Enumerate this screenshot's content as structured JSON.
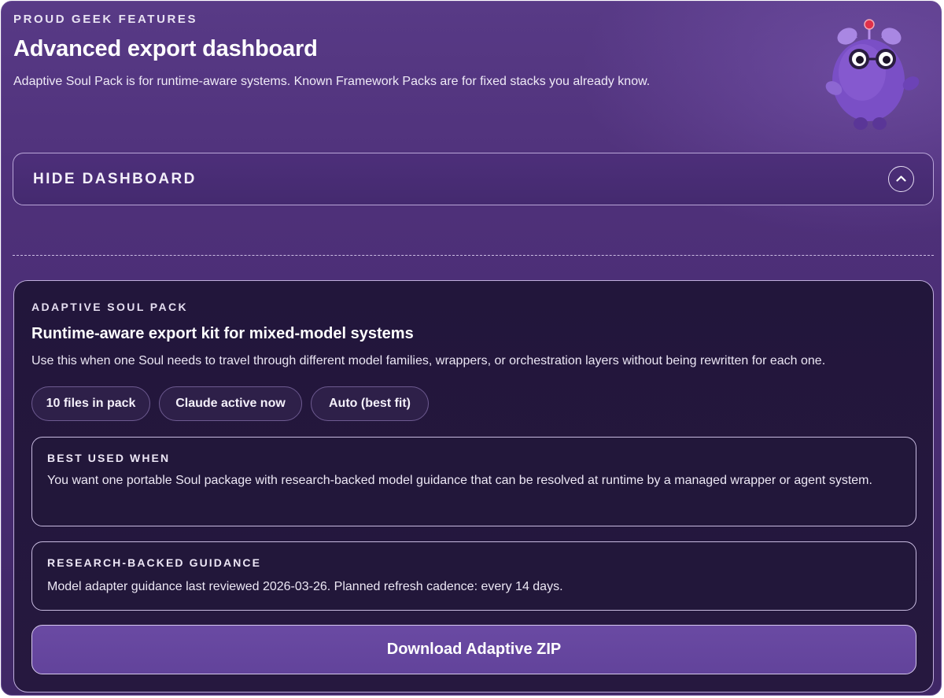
{
  "header": {
    "eyebrow": "PROUD GEEK FEATURES",
    "title": "Advanced export dashboard",
    "subtitle": "Adaptive Soul Pack is for runtime-aware systems. Known Framework Packs are for fixed stacks you already know."
  },
  "toggle": {
    "label": "HIDE DASHBOARD",
    "icon": "chevron-up-icon"
  },
  "pack": {
    "eyebrow": "ADAPTIVE SOUL PACK",
    "title": "Runtime-aware export kit for mixed-model systems",
    "description": "Use this when one Soul needs to travel through different model families, wrappers, or orchestration layers without being rewritten for each one.",
    "chips": [
      "10 files in pack",
      "Claude active now",
      "Auto (best fit)"
    ],
    "best_used": {
      "heading": "BEST USED WHEN",
      "text": "You want one portable Soul package with research-backed model guidance that can be resolved at runtime by a managed wrapper or agent system."
    },
    "research": {
      "heading": "RESEARCH-BACKED GUIDANCE",
      "text": "Model adapter guidance last reviewed 2026-03-26. Planned refresh cadence: every 14 days."
    },
    "download_label": "Download Adaptive ZIP"
  },
  "colors": {
    "background": "#4e3079",
    "card": "#22163b",
    "button": "#6a4aa3",
    "mascot": "#7a4fc6"
  }
}
